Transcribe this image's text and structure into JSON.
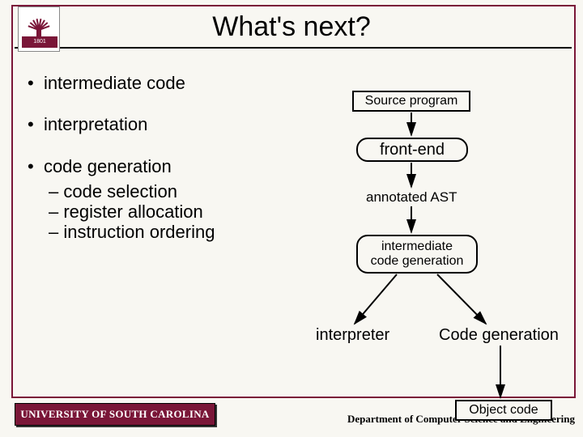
{
  "title": "What's next?",
  "bullets": {
    "b1": "intermediate code",
    "b2": "interpretation",
    "b3": "code generation",
    "b3a": "code selection",
    "b3b": "register allocation",
    "b3c": "instruction ordering"
  },
  "diagram": {
    "source": "Source program",
    "frontend": "front-end",
    "ast": "annotated AST",
    "icg_l1": "intermediate",
    "icg_l2": "code generation",
    "interpreter": "interpreter",
    "codegen": "Code generation",
    "object": "Object code"
  },
  "footer": {
    "university": "UNIVERSITY OF SOUTH CAROLINA",
    "dept": "Department of Computer Science and Engineering"
  },
  "logo": {
    "year": "1801"
  }
}
